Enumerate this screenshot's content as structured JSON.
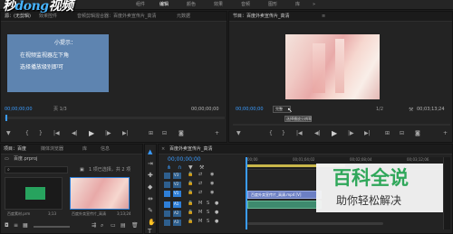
{
  "brand": {
    "text_a": "秒",
    "text_b": "dong",
    "text_c": "视频"
  },
  "topbar": {
    "items": [
      "组件",
      "编辑",
      "颜色",
      "效果",
      "音频",
      "图形",
      "库"
    ]
  },
  "source_panel": {
    "tabs": [
      "源：(无剪辑)",
      "效果控件",
      "音频剪辑混合器：百度外卖宣传片_高清",
      "元数据"
    ],
    "tip_title": "小提示：",
    "tip_line1": "在视频监视器左下角",
    "tip_line2": "选择播放级别即可",
    "timecode_left": "00;00;00;00",
    "fit_label": "页 1/3",
    "timecode_right": "00;00;00;00"
  },
  "program_panel": {
    "tab": "节目：百度外卖宣传片_高清",
    "timecode_left": "00;00;00;00",
    "resolution_option": "完整",
    "tooltip": "选择播放分辨率",
    "page_label": "1/2",
    "timecode_right": "00;03;13;24"
  },
  "project_panel": {
    "tabs": [
      "项目：百度",
      "媒体浏览器",
      "库",
      "信息"
    ],
    "path": "百度.prproj",
    "item_count": "1 项已选择，共 2 项",
    "items": [
      {
        "name": "百度素材.prm",
        "duration": "3;13"
      },
      {
        "name": "百度外卖宣传片_高清",
        "duration": "3;13;24"
      }
    ]
  },
  "timeline_panel": {
    "tab": "百度外卖宣传片_高清",
    "timecode": "00;00;00;00",
    "ruler_times": [
      "00;00",
      "00;01;04;02",
      "00;02;08;04",
      "00;03;12;06"
    ],
    "video_tracks": [
      "V3",
      "V2",
      "V1"
    ],
    "audio_tracks": [
      "A1",
      "A2",
      "A3"
    ],
    "clip_label": "百度外卖宣传片_高清.mp4 [V]"
  },
  "watermark": {
    "title": "百科全说",
    "subtitle": "助你轻松解决"
  }
}
